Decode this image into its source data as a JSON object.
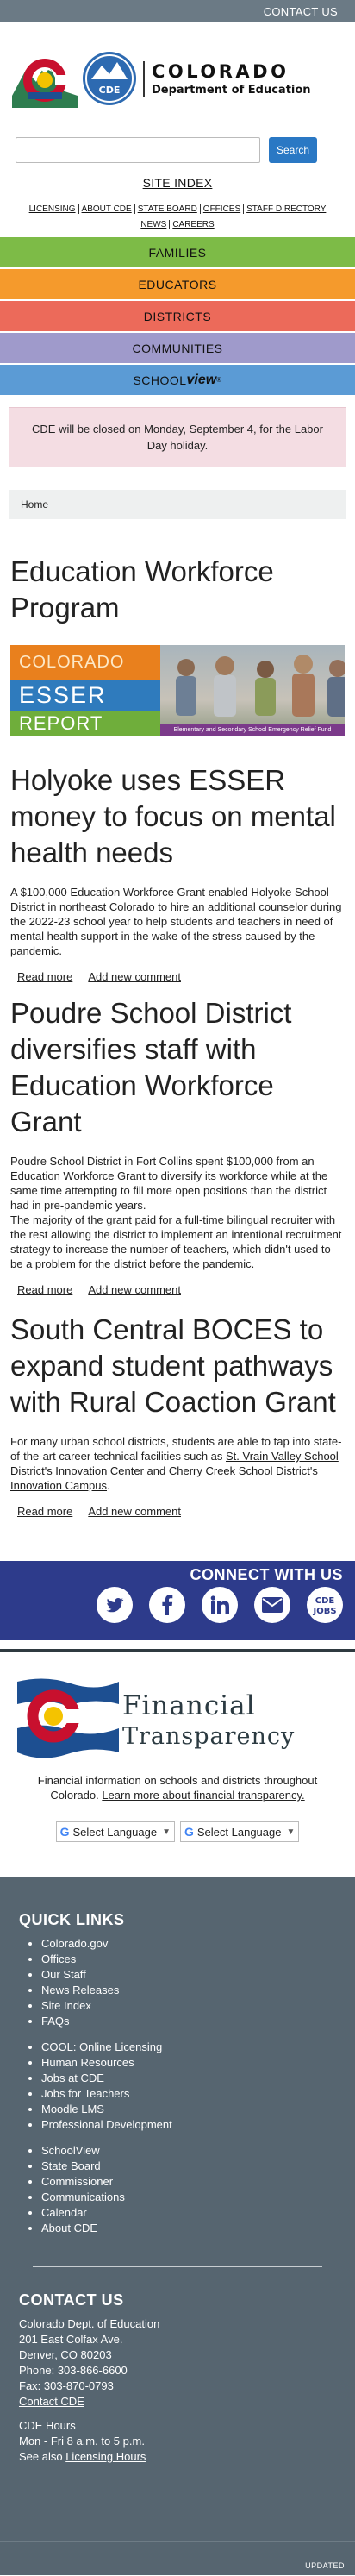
{
  "topbar": {
    "contact_us": "CONTACT US"
  },
  "logo": {
    "cde_badge": "CDE",
    "line1": "COLORADO",
    "line2": "Department of Education"
  },
  "search": {
    "placeholder": "",
    "button": "Search"
  },
  "site_index": "SITE INDEX",
  "util_links": [
    "LICENSING",
    "ABOUT CDE",
    "STATE BOARD",
    "OFFICES",
    "STAFF DIRECTORY",
    "NEWS",
    "CAREERS"
  ],
  "main_nav": [
    {
      "label": "FAMILIES",
      "color": "#7dbb47"
    },
    {
      "label": "EDUCATORS",
      "color": "#f59a2c"
    },
    {
      "label": "DISTRICTS",
      "color": "#ec6a5a"
    },
    {
      "label": "COMMUNITIES",
      "color": "#9f9acb"
    }
  ],
  "schoolview": {
    "part1": "SCHOOL",
    "part2": "view",
    "mark": "®",
    "color": "#5b9bd5"
  },
  "alert": "CDE will be closed on Monday, September 4, for the Labor Day holiday.",
  "breadcrumb": "Home",
  "page_title": "Education Workforce Program",
  "banner": {
    "l1": "COLORADO",
    "l2": "ESSER",
    "l3": "REPORT",
    "caption": "Elementary and Secondary School Emergency Relief Fund"
  },
  "articles": [
    {
      "title": "Holyoke uses ESSER money to focus on mental health needs",
      "paragraphs": [
        "A $100,000 Education Workforce Grant enabled Holyoke School District in northeast Colorado to hire an additional counselor during the 2022-23 school year to help students and teachers in need of mental health support in the wake of the stress caused by the pandemic."
      ],
      "read_more": "Read more",
      "add_comment": "Add new comment"
    },
    {
      "title": "Poudre School District diversifies staff with Education Workforce Grant",
      "paragraphs": [
        "Poudre School District in Fort Collins spent $100,000 from an Education Workforce Grant to diversify its workforce while at the same time attempting to fill more open positions than the district had in pre-pandemic years.",
        "The majority of the grant paid for a full-time bilingual recruiter with the rest allowing the district to implement an intentional recruitment strategy to increase the number of teachers, which didn't used to be a problem for the district before the pandemic."
      ],
      "read_more": "Read more",
      "add_comment": "Add new comment"
    },
    {
      "title": "South Central BOCES to expand student pathways with Rural Coaction Grant",
      "text_before": "For many urban school districts, students are able to tap into state-of-the-art career technical facilities such as ",
      "link1": "St. Vrain Valley School District's Innovation Center",
      "text_mid": " and ",
      "link2": "Cherry Creek School District's Innovation Campus",
      "text_after": ".",
      "read_more": "Read more",
      "add_comment": "Add new comment"
    }
  ],
  "connect": {
    "title": "CONNECT WITH US",
    "icons": [
      "twitter-icon",
      "facebook-icon",
      "linkedin-icon",
      "email-icon",
      "cde-jobs-icon"
    ],
    "jobs_l1": "CDE",
    "jobs_l2": "JOBS"
  },
  "financial": {
    "line1": "Financial",
    "line2": "Transparency",
    "desc": "Financial information on schools and districts throughout Colorado.",
    "link": "Learn more about financial transparency."
  },
  "translate": {
    "g": "G",
    "label": "Select Language",
    "arrow": "▼"
  },
  "footer": {
    "quick_links_title": "QUICK LINKS",
    "group1": [
      "Colorado.gov",
      "Offices",
      "Our Staff",
      "News Releases",
      "Site Index",
      "FAQs"
    ],
    "group2": [
      "COOL: Online Licensing",
      "Human Resources",
      "Jobs at CDE",
      "Jobs for Teachers",
      "Moodle LMS",
      "Professional Development"
    ],
    "group3": [
      "SchoolView",
      "State Board",
      "Commissioner",
      "Communications",
      "Calendar",
      "About CDE"
    ],
    "contact_title": "CONTACT US",
    "contact_lines": [
      "Colorado Dept. of Education",
      "201 East Colfax Ave.",
      "Denver, CO 80203",
      "Phone: 303-866-6600",
      "Fax: 303-870-0793"
    ],
    "contact_link": "Contact CDE",
    "hours_title": "CDE Hours",
    "hours": "Mon - Fri 8 a.m. to 5 p.m.",
    "see_also": "See also ",
    "licensing_hours": "Licensing Hours"
  },
  "bottom": {
    "updated": "UPDATED"
  }
}
